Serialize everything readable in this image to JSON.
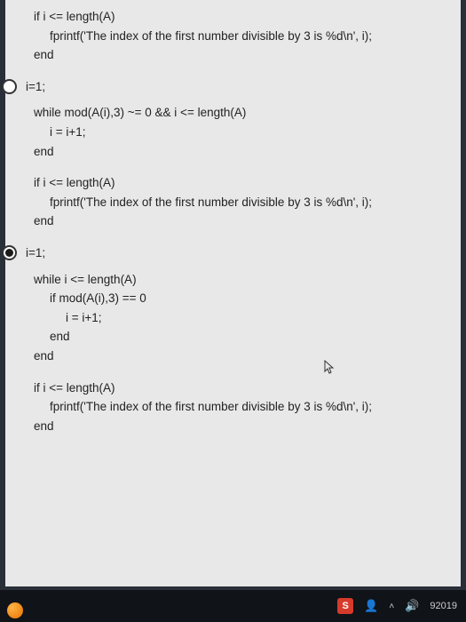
{
  "block_top": {
    "l1": "if i <= length(A)",
    "l2": "fprintf('The index of the first number divisible by 3 is %d\\n', i);",
    "l3": "end"
  },
  "option_a": {
    "header": "i=1;",
    "while_l1": "while mod(A(i),3) ~= 0 && i <= length(A)",
    "while_l2": "i = i+1;",
    "while_l3": "end",
    "if_l1": "if i <= length(A)",
    "if_l2": "fprintf('The index of the first number divisible by 3 is %d\\n', i);",
    "if_l3": "end"
  },
  "option_b": {
    "header": "i=1;",
    "while_l1": "while  i <= length(A)",
    "while_l2": "if mod(A(i),3) == 0",
    "while_l3": "i = i+1;",
    "while_l4": "end",
    "while_l5": "end",
    "if_l1": "if i <= length(A)",
    "if_l2": "fprintf('The index of the first number divisible by 3 is %d\\n', i);",
    "if_l3": "end"
  },
  "taskbar": {
    "s_label": "S",
    "time": "9",
    "date": "2019"
  }
}
